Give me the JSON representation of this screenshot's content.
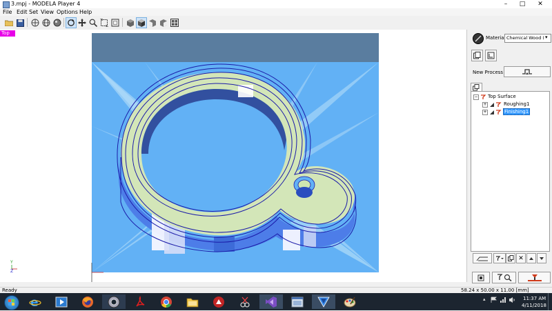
{
  "window": {
    "title": "3.mpj - MODELA Player 4"
  },
  "menu": [
    "File",
    "Edit",
    "Set",
    "View",
    "Options",
    "Help"
  ],
  "toolbar": {
    "icons": [
      "open-icon",
      "save-icon",
      "view-whole-icon",
      "view-globe-icon",
      "view-sphere-icon",
      "rotate-icon",
      "pan-icon",
      "zoom-icon",
      "fit-icon",
      "zoom-window-icon",
      "shaded-view-icon",
      "iso-view-icon",
      "front-view-icon",
      "side-view-icon",
      "grid-view-icon"
    ]
  },
  "viewport": {
    "view_label": "Top"
  },
  "right_panel": {
    "material_label": "Material",
    "material_value": "Chemical Wood (Ha",
    "new_process_label": "New Process",
    "tree": {
      "root": "Top Surface",
      "items": [
        "Roughing1",
        "Finishing1"
      ]
    }
  },
  "status": {
    "left": "Ready",
    "dims": "58.24 x 50.00 x 11.00 [mm]"
  },
  "taskbar": {
    "time": "11:37 AM",
    "date": "4/11/2018"
  },
  "colors": {
    "background_blue": "#62b1f5",
    "top_strip": "#5a7d9f",
    "toolpath": "#1a1aa8",
    "surface_light": "#d3e6b8",
    "side_wall": "#4d7de8",
    "selection": "#3399ff",
    "badge": "#e800e8"
  }
}
